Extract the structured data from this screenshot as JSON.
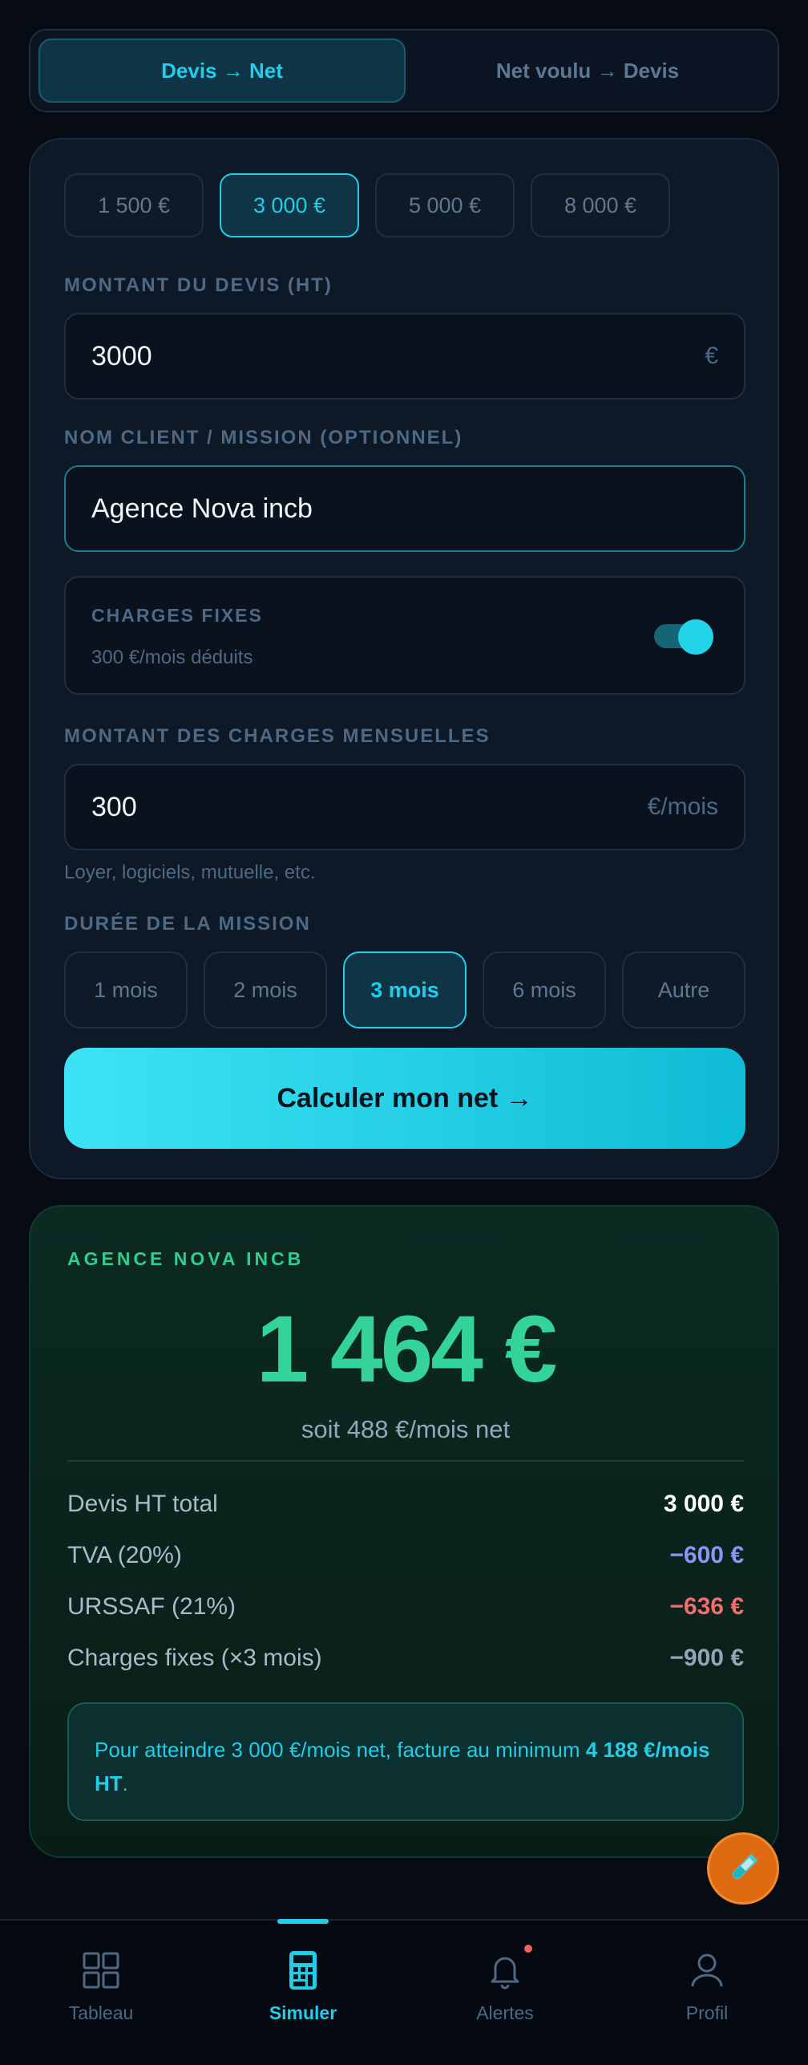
{
  "mode_toggle": {
    "option_quote_to_net": "Devis → Net",
    "option_net_to_quote": "Net voulu → Devis"
  },
  "quick_amounts": [
    "1 500 €",
    "3 000 €",
    "5 000 €",
    "8 000 €"
  ],
  "quote_amount": {
    "label": "MONTANT DU DEVIS (HT)",
    "value": "3000",
    "unit": "€"
  },
  "client": {
    "label": "NOM CLIENT / MISSION (OPTIONNEL)",
    "value": "Agence Nova incb"
  },
  "fixed_charges": {
    "title": "CHARGES FIXES",
    "subtitle": "300 €/mois déduits",
    "enabled": true
  },
  "monthly_charges": {
    "label": "MONTANT DES CHARGES MENSUELLES",
    "value": "300",
    "unit": "€/mois",
    "hint": "Loyer, logiciels, mutuelle, etc."
  },
  "duration": {
    "label": "DURÉE DE LA MISSION",
    "options": [
      "1 mois",
      "2 mois",
      "3 mois",
      "6 mois",
      "Autre"
    ],
    "selected": "3 mois"
  },
  "cta_label": "Calculer mon net →",
  "result": {
    "client": "AGENCE NOVA INCB",
    "net_amount": "1 464 €",
    "per_month": "soit 488 €/mois net",
    "rows": [
      {
        "label": "Devis HT total",
        "amount": "3 000 €",
        "color": "#ffffff"
      },
      {
        "label": "TVA (20%)",
        "amount": "−600 €",
        "color": "#8b95f5"
      },
      {
        "label": "URSSAF (21%)",
        "amount": "−636 €",
        "color": "#f26d6d"
      },
      {
        "label": "Charges fixes (×3 mois)",
        "amount": "−900 €",
        "color": "#93a3b8"
      }
    ],
    "tip_prefix": "Pour atteindre 3 000 €/mois net, facture au minimum ",
    "tip_bold": "4 188 €/mois HT",
    "tip_suffix": "."
  },
  "fab_icon": "test-tube-icon",
  "nav": [
    {
      "label": "Tableau",
      "icon": "grid-icon"
    },
    {
      "label": "Simuler",
      "icon": "calculator-icon",
      "active": true
    },
    {
      "label": "Alertes",
      "icon": "bell-icon",
      "has_dot": true
    },
    {
      "label": "Profil",
      "icon": "user-icon"
    }
  ],
  "colors": {
    "accent": "#22cde8",
    "success": "#34d399",
    "background": "#060b14"
  }
}
